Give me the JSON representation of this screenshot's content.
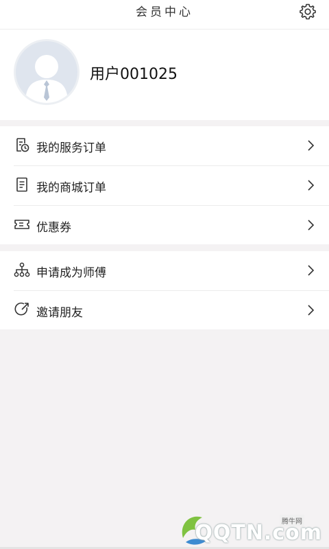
{
  "header": {
    "title": "会员中心",
    "settings_icon": "gear-icon"
  },
  "profile": {
    "username": "用户001025",
    "avatar_icon": "default-user-avatar"
  },
  "menu_group_1": [
    {
      "label": "我的服务订单",
      "icon": "service-order-icon"
    },
    {
      "label": "我的商城订单",
      "icon": "mall-order-icon"
    },
    {
      "label": "优惠券",
      "icon": "coupon-icon"
    }
  ],
  "menu_group_2": [
    {
      "label": "申请成为师傅",
      "icon": "network-icon"
    },
    {
      "label": "邀请朋友",
      "icon": "share-icon"
    }
  ],
  "watermark": {
    "tag": "腾牛网",
    "text": "QQTN.com"
  },
  "colors": {
    "background": "#f4f2f3",
    "card": "#ffffff",
    "divider": "#ececec",
    "avatar_bg": "#dfe5ee"
  }
}
